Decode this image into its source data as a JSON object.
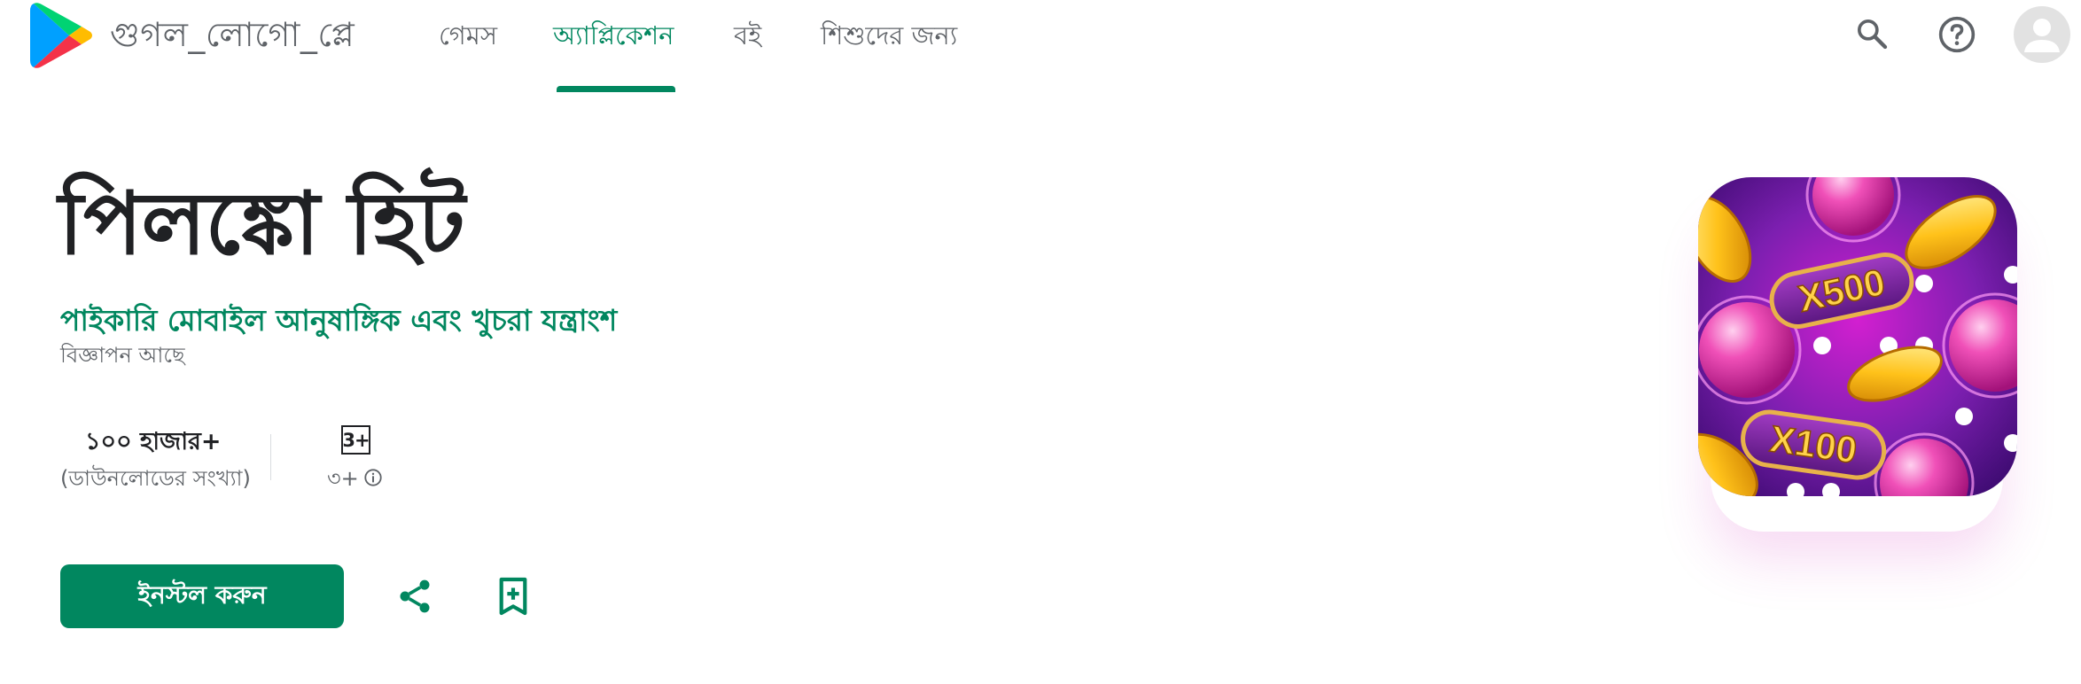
{
  "header": {
    "logo_text": "গুগল_লোগো_প্লে",
    "tabs": [
      {
        "label": "গেমস",
        "active": false
      },
      {
        "label": "অ্যাপ্লিকেশন",
        "active": true
      },
      {
        "label": "বই",
        "active": false
      },
      {
        "label": "শিশুদের জন্য",
        "active": false
      }
    ],
    "icons": [
      "search-icon",
      "help-icon",
      "avatar"
    ],
    "accent_color": "#01875f"
  },
  "app": {
    "title": "পিলঙ্কো হিট",
    "developer": "পাইকারি মোবাইল আনুষাঙ্গিক এবং খুচরা যন্ত্রাংশ",
    "ads_note": "বিজ্ঞাপন আছে",
    "downloads": {
      "value": "১০০ হাজার+",
      "label": "(ডাউনলোডের সংখ্যা)"
    },
    "rating": {
      "badge": "3+",
      "label": "৩+"
    },
    "install_label": "ইনস্টল করুন",
    "actions": [
      "share-icon",
      "wishlist-icon"
    ],
    "icon_text": {
      "top_multiplier": "X500",
      "bottom_multiplier": "X100"
    }
  }
}
